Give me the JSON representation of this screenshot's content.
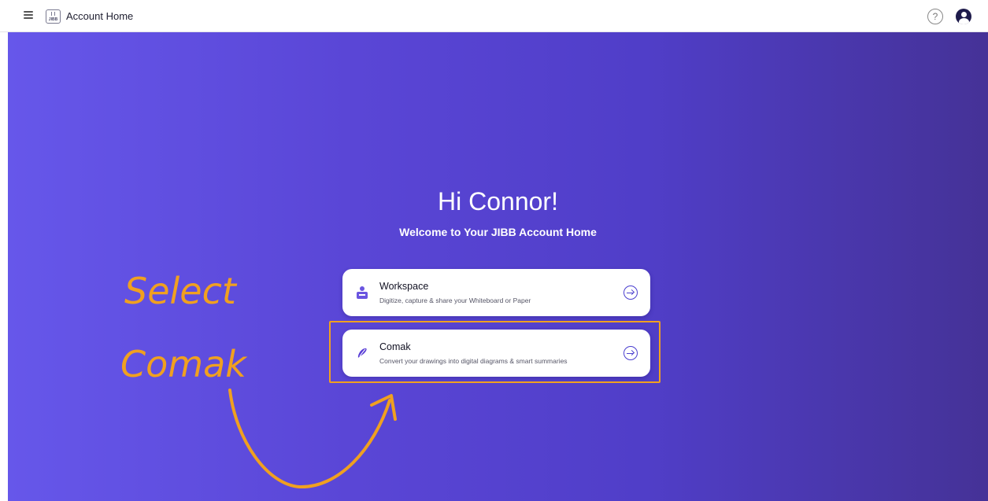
{
  "header": {
    "title": "Account Home",
    "logo_text": "JIBB",
    "menu_icon": "hamburger-menu-icon",
    "help_icon": "help-circle-icon",
    "help_glyph": "?",
    "user_icon": "user-avatar-icon"
  },
  "main": {
    "greeting": "Hi Connor!",
    "welcome": "Welcome to Your JIBB Account Home",
    "cards": [
      {
        "title": "Workspace",
        "description": "Digitize, capture & share your Whiteboard or Paper",
        "icon": "workspace-icon",
        "action_icon": "arrow-right-circle-icon"
      },
      {
        "title": "Comak",
        "description": "Convert your drawings into digital diagrams & smart summaries",
        "icon": "comak-icon",
        "action_icon": "arrow-right-circle-icon"
      }
    ]
  },
  "annotation": {
    "lines": [
      "Select",
      "Comak"
    ],
    "color": "#f0a020",
    "highlighted_card": "Comak"
  },
  "colors": {
    "accent": "#4b3fcf",
    "hero_gradient_start": "#6657ea",
    "hero_gradient_end": "#453297",
    "annotation": "#f0a020"
  }
}
